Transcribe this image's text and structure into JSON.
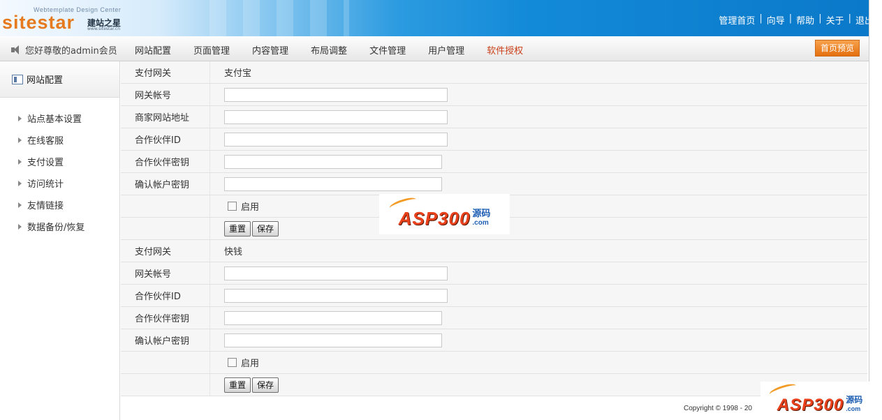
{
  "header": {
    "logo_sub": "Webtemplate Design Center",
    "logo": "sitestar",
    "logo_cn": "建站之星",
    "logo_url": "www.sitestar.cn",
    "links": [
      "管理首页",
      "向导",
      "帮助",
      "关于",
      "退出"
    ]
  },
  "nav": {
    "welcome": "您好尊敬的admin会员",
    "items": [
      "网站配置",
      "页面管理",
      "内容管理",
      "布局调整",
      "文件管理",
      "用户管理",
      "软件授权"
    ],
    "preview_label": "首页预览"
  },
  "sidebar": {
    "title": "网站配置",
    "items": [
      "站点基本设置",
      "在线客服",
      "支付设置",
      "访问统计",
      "友情链接",
      "数据备份/恢复"
    ]
  },
  "form1": {
    "gateway_label": "支付网关",
    "gateway_value": "支付宝",
    "account_label": "网关帐号",
    "site_url_label": "商家网站地址",
    "partner_id_label": "合作伙伴ID",
    "partner_key_label": "合作伙伴密钥",
    "confirm_key_label": "确认帐户密钥",
    "enable_label": "启用",
    "reset_label": "重置",
    "save_label": "保存"
  },
  "form2": {
    "gateway_label": "支付网关",
    "gateway_value": "快钱",
    "account_label": "网关帐号",
    "partner_id_label": "合作伙伴ID",
    "partner_key_label": "合作伙伴密钥",
    "confirm_key_label": "确认帐户密钥",
    "enable_label": "启用",
    "reset_label": "重置",
    "save_label": "保存"
  },
  "footer": {
    "copyright": "Copyright © 1998 - 20"
  },
  "watermark": {
    "brand": "ASP300",
    "cn": "源码",
    "domain": ".com"
  }
}
